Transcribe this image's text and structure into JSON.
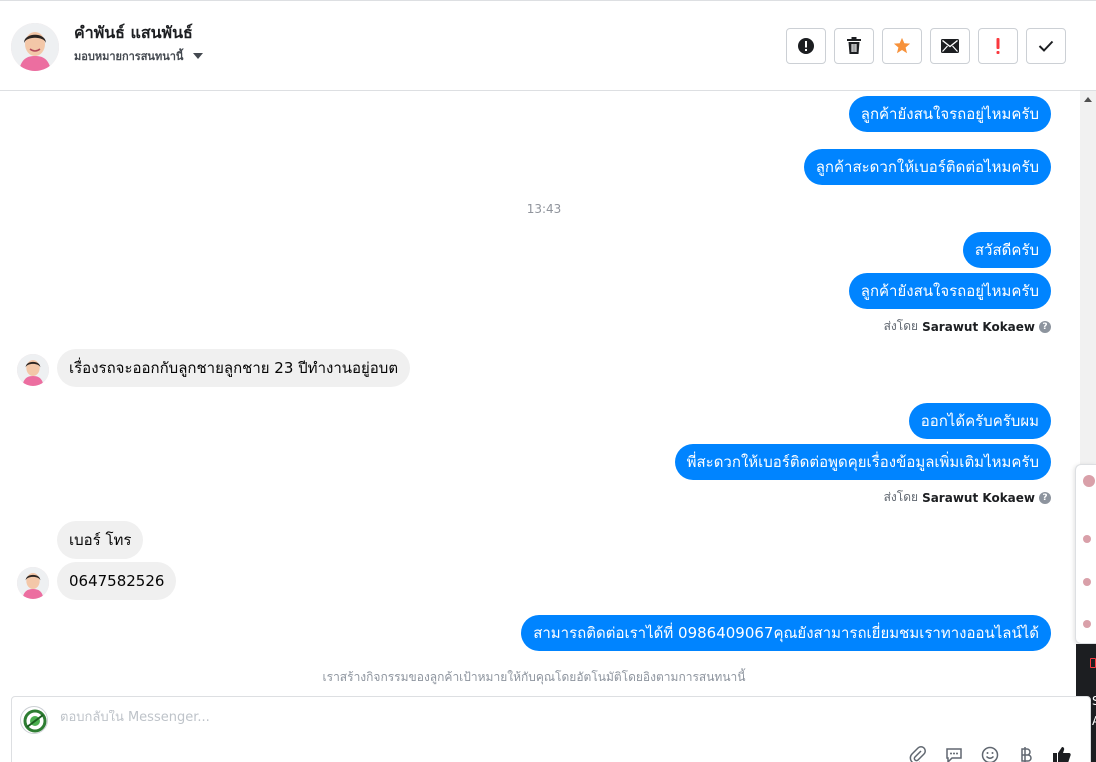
{
  "header": {
    "contact_name": "คำพันธ์ แสนพันธ์",
    "assign_label": "มอบหมายการสนทนานี้",
    "actions": [
      {
        "name": "mark-spam-button",
        "icon": "alert-circle-icon"
      },
      {
        "name": "delete-button",
        "icon": "trash-icon"
      },
      {
        "name": "star-button",
        "icon": "star-icon"
      },
      {
        "name": "mark-unread-button",
        "icon": "envelope-icon"
      },
      {
        "name": "follow-up-button",
        "icon": "exclamation-icon"
      },
      {
        "name": "mark-done-button",
        "icon": "check-icon"
      }
    ]
  },
  "messages": {
    "m1": "ลูกค้ายังสนใจรถอยู่ไหมครับ",
    "m2": "ลูกค้าสะดวกให้เบอร์ติดต่อไหมครับ",
    "timestamp": "13:43",
    "m3": "สวัสดีครับ",
    "m4": "ลูกค้ายังสนใจรถอยู่ไหมครับ",
    "sent_by_1_prefix": "ส่งโดย",
    "sent_by_1_name": "Sarawut Kokaew",
    "m5": "เรื่องรถจะออกกับลูกชายลูกชาย 23 ปีทำงานอยู่อบต",
    "m6": "ออกได้ครับครับผม",
    "m7": "พี่สะดวกให้เบอร์ติดต่อพูดคุยเรื่องข้อมูลเพิ่มเติมไหมครับ",
    "sent_by_2_prefix": "ส่งโดย",
    "sent_by_2_name": "Sarawut Kokaew",
    "m8": "เบอร์ โทร",
    "m9": "0647582526",
    "m10": "สามารถติดต่อเราได้ที่ 0986409067คุณยังสามารถเยี่ยมชมเราทางออนไลน์ได้",
    "auto_note": "เราสร้างกิจกรรมของลูกค้าเป้าหมายให้กับคุณโดยอัตโนมัติโดยอิงตามการสนทนานี้"
  },
  "composer": {
    "placeholder": "ตอบกลับใน Messenger..."
  },
  "side_panel": {
    "dark_letters": [
      "S",
      "A"
    ]
  },
  "colors": {
    "outgoing_bubble": "#0084ff",
    "incoming_bubble": "#f0f0f0",
    "star": "#f7923b",
    "follow_up": "#fa383e"
  }
}
